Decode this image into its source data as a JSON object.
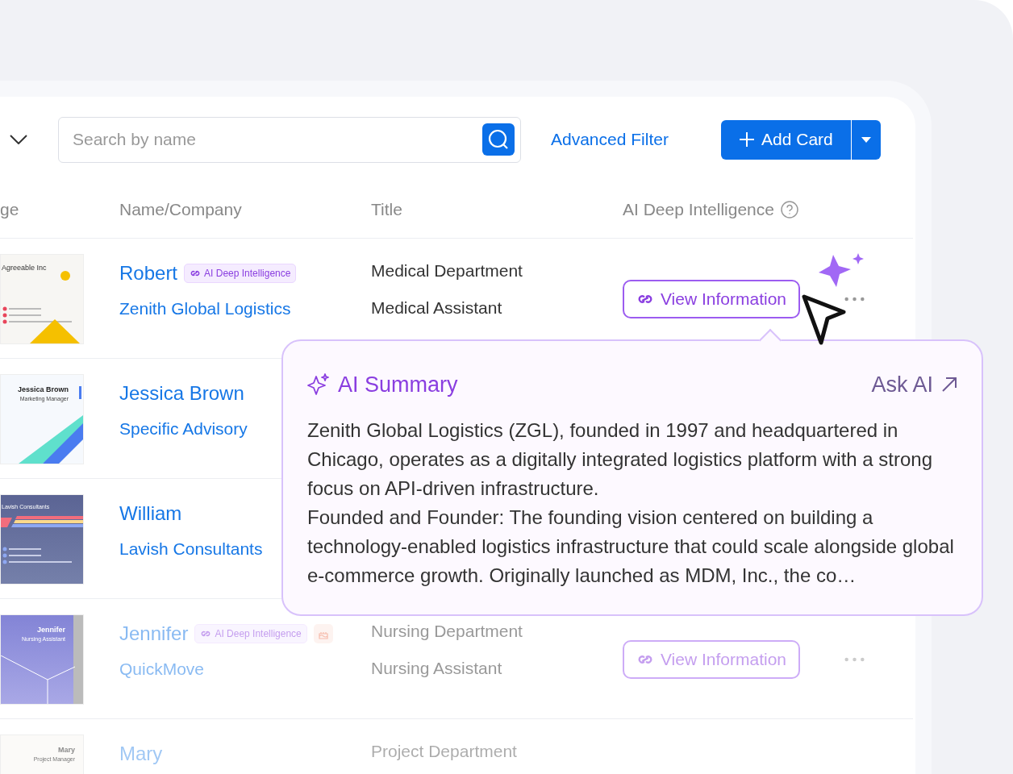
{
  "toolbar": {
    "search": {
      "placeholder": "Search by name"
    },
    "filter_link": "Advanced Filter",
    "add_button": "Add Card"
  },
  "columns": [
    "ge",
    "Name/Company",
    "Title",
    "AI Deep Intelligence"
  ],
  "rows": [
    {
      "kind": "normal",
      "card": {
        "kind": "yellow",
        "title": "Agreeable Inc"
      },
      "name": "Robert",
      "tag": "AI Deep Intelligence",
      "birthday": false,
      "company": "Zenith Global Logistics",
      "department": "Medical Department",
      "position": "Medical Assistant",
      "action": "View Information"
    },
    {
      "kind": "normal",
      "card": {
        "kind": "wave",
        "title": "Jessica Brown",
        "subtitle": "Marketing Manager"
      },
      "name": "Jessica Brown",
      "birthday": false,
      "company": "Specific Advisory"
    },
    {
      "kind": "normal",
      "card": {
        "kind": "stripes",
        "title": "Lavish Consultants"
      },
      "name": "William",
      "birthday": false,
      "company": "Lavish Consultants"
    },
    {
      "kind": "faded",
      "card": {
        "kind": "violet",
        "title": "Jennifer",
        "subtitle": "Nursing Assistant"
      },
      "name": "Jennifer",
      "tag": "AI Deep Intelligence",
      "birthday": true,
      "company": "QuickMove",
      "department": "Nursing Department",
      "position": "Nursing Assistant",
      "action": "View Information"
    },
    {
      "kind": "ghost",
      "card": {
        "kind": "plain",
        "title": "Mary",
        "subtitle": "Project Manager"
      },
      "name": "Mary",
      "birthday": false,
      "department": "Project Department"
    }
  ],
  "popup": {
    "title": "AI Summary",
    "ask": "Ask AI",
    "paragraphs": [
      "Zenith Global Logistics (ZGL), founded in 1997 and headquartered in Chicago, operates as a digitally integrated logistics platform with a strong focus on API-driven infrastructure.",
      "Founded and Founder: The founding vision centered on building a technology-enabled logistics infrastructure that could scale alongside global e-commerce growth. Originally launched as MDM, Inc., the co…"
    ]
  }
}
